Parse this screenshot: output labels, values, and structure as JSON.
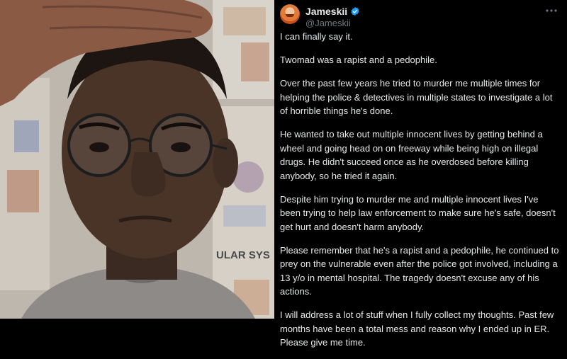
{
  "tweet": {
    "display_name": "Jameskii",
    "handle": "@Jameskii",
    "paragraphs": [
      "I can finally say it.",
      "Twomad was a rapist and a pedophile.",
      "Over the past few years he tried to murder me multiple times for helping the police & detectives in multiple states to investigate a lot of horrible things he's done.",
      "He wanted to take out multiple innocent lives by getting behind a wheel and going head on on freeway while being high on illegal drugs. He didn't succeed once as he overdosed before killing anybody, so he tried it again.",
      "Despite him trying to murder me and multiple innocent lives I've been trying to help law enforcement to make sure he's safe, doesn't get hurt and doesn't harm anybody.",
      "Please remember that he's a rapist and a pedophile, he continued to prey on the vulnerable even after the police got involved, including a 13 y/o in mental hospital. The tragedy doesn't excuse any of his actions.",
      "I will address a lot of stuff when I fully collect my thoughts. Past few months have been a total mess and  reason why I ended up in ER. Please give me time."
    ]
  },
  "photo": {
    "poster_text": "ULAR SYS"
  },
  "icons": {
    "verified": "verified-badge-icon",
    "more": "more-options-icon"
  },
  "colors": {
    "background": "#000000",
    "text": "#e7e9ea",
    "muted": "#71767b",
    "verified_blue": "#1d9bf0"
  }
}
